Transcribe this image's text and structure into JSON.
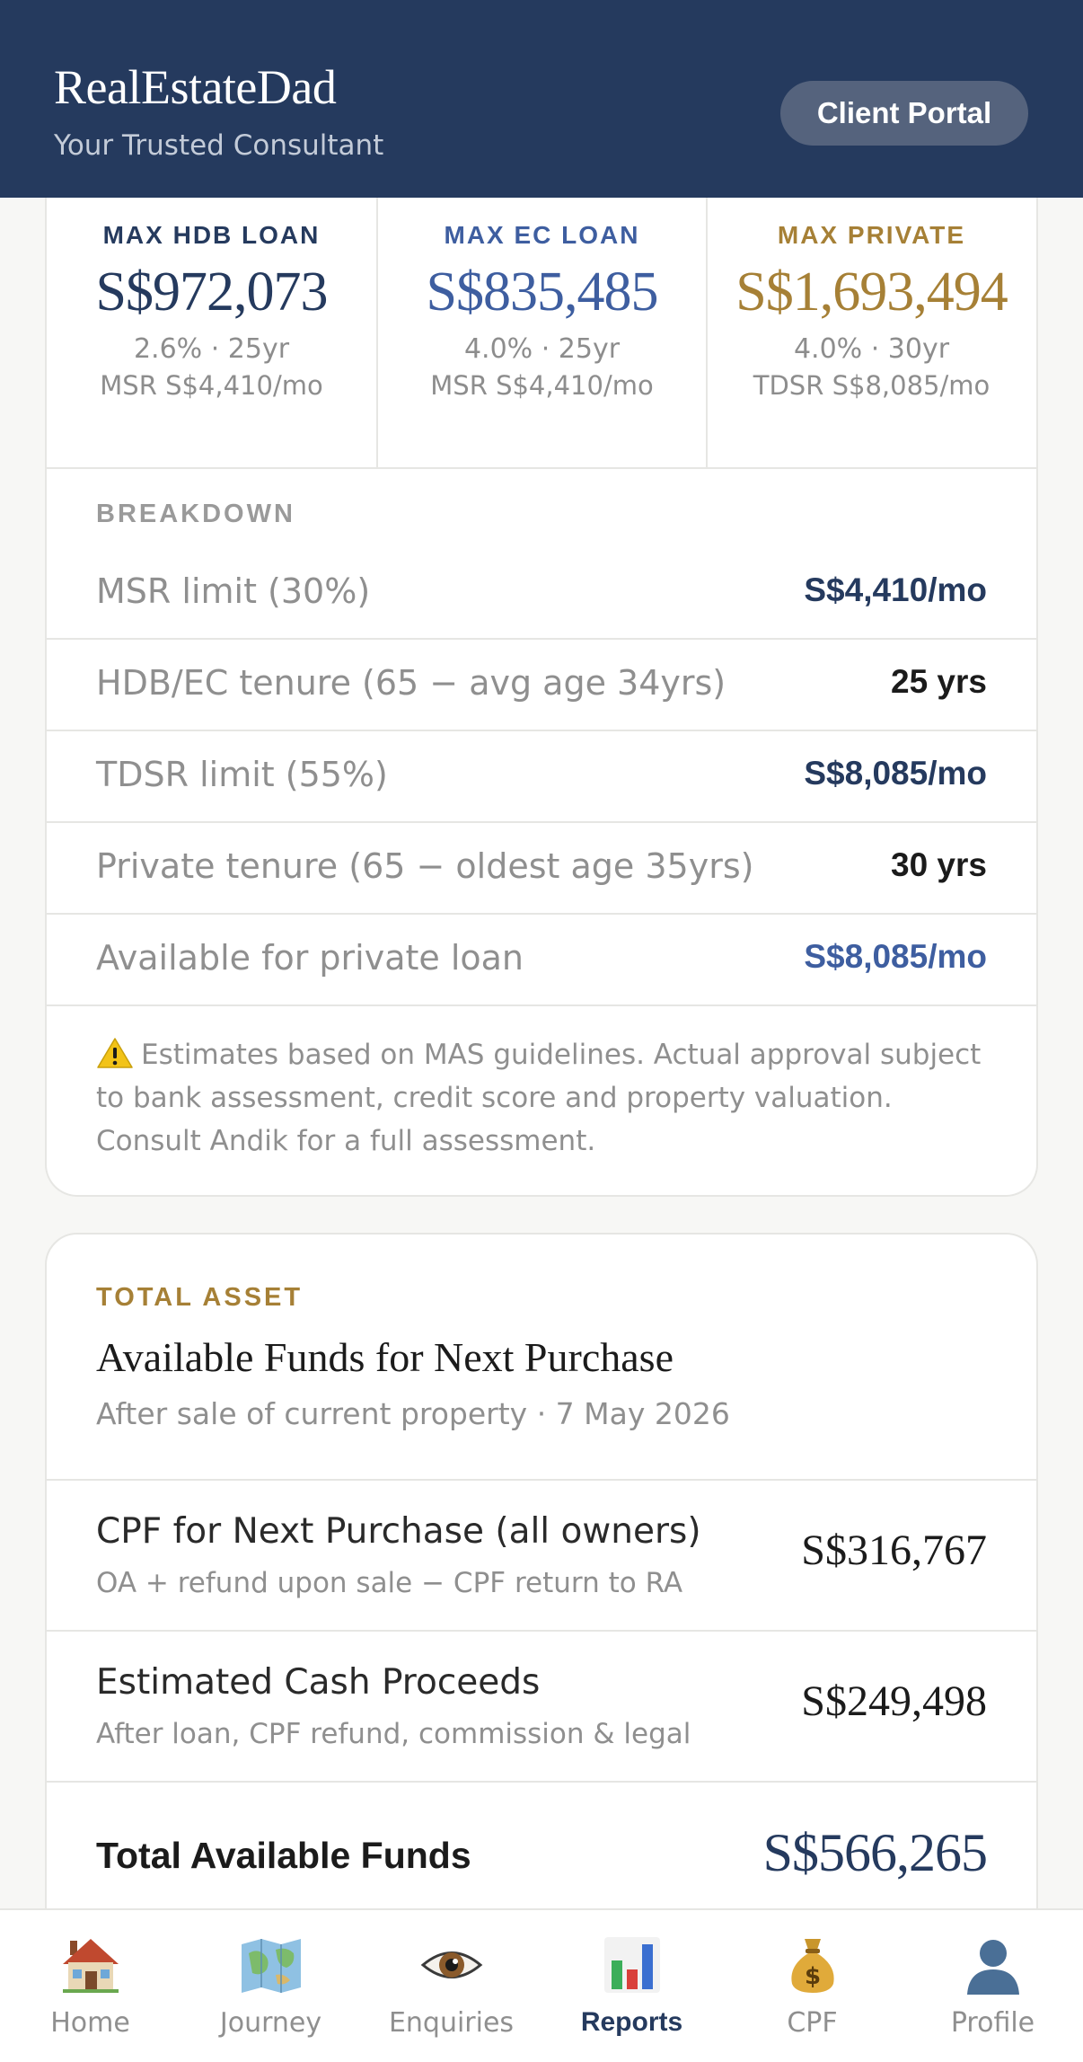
{
  "header": {
    "brand": "RealEstateDad",
    "tagline": "Your Trusted Consultant",
    "portal_button": "Client Portal"
  },
  "loans": [
    {
      "label": "MAX HDB LOAN",
      "amount": "S$972,073",
      "rate": "2.6% · 25yr",
      "ratio": "MSR S$4,410/mo",
      "color": "#253a5e"
    },
    {
      "label": "MAX EC LOAN",
      "amount": "S$835,485",
      "rate": "4.0% · 25yr",
      "ratio": "MSR S$4,410/mo",
      "color": "#3e5ea0"
    },
    {
      "label": "MAX PRIVATE",
      "amount": "S$1,693,494",
      "rate": "4.0% · 30yr",
      "ratio": "TDSR S$8,085/mo",
      "color": "#a68036"
    }
  ],
  "breakdown": {
    "caption": "BREAKDOWN",
    "rows": [
      {
        "label": "MSR limit (30%)",
        "value": "S$4,410/mo",
        "color": "#253a5e"
      },
      {
        "label": "HDB/EC tenure (65 − avg age 34yrs)",
        "value": "25 yrs",
        "color": "#1b1b1b"
      },
      {
        "label": "TDSR limit (55%)",
        "value": "S$8,085/mo",
        "color": "#253a5e"
      },
      {
        "label": "Private tenure (65 − oldest age 35yrs)",
        "value": "30 yrs",
        "color": "#1b1b1b"
      },
      {
        "label": "Available for private loan",
        "value": "S$8,085/mo",
        "color": "#3e5ea0"
      }
    ],
    "note": "Estimates based on MAS guidelines. Actual approval subject to bank assessment, credit score and property valuation. Consult Andik for a full assessment."
  },
  "total_asset": {
    "caption": "TOTAL ASSET",
    "title": "Available Funds for Next Purchase",
    "subtitle": "After sale of current property · 7 May 2026",
    "rows": [
      {
        "label": "CPF for Next Purchase (all owners)",
        "sub": "OA + refund upon sale − CPF return to RA",
        "value": "S$316,767"
      },
      {
        "label": "Estimated Cash Proceeds",
        "sub": "After loan, CPF refund, commission & legal",
        "value": "S$249,498"
      }
    ],
    "total_label": "Total Available Funds",
    "total_value": "S$566,265"
  },
  "nav": [
    {
      "label": "Home",
      "icon": "house-icon"
    },
    {
      "label": "Journey",
      "icon": "map-icon"
    },
    {
      "label": "Enquiries",
      "icon": "eye-icon"
    },
    {
      "label": "Reports",
      "icon": "bar-chart-icon",
      "active": true
    },
    {
      "label": "CPF",
      "icon": "money-bag-icon"
    },
    {
      "label": "Profile",
      "icon": "profile-icon"
    }
  ]
}
